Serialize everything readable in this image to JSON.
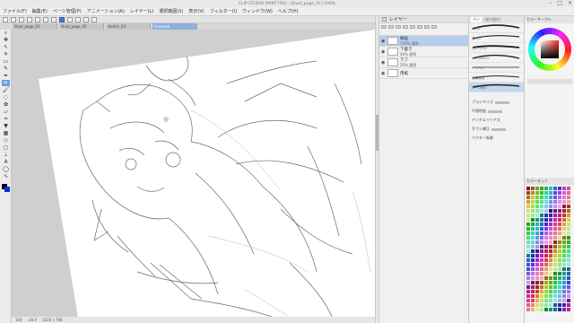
{
  "window": {
    "title": "CLIP STUDIO PAINT PRO - [illust_page_01] 100%"
  },
  "menu": {
    "items": [
      "ファイル(F)",
      "編集(E)",
      "ページ管理(P)",
      "アニメーション(A)",
      "レイヤー(L)",
      "選択範囲(S)",
      "表示(V)",
      "フィルター(I)",
      "ウィンドウ(W)",
      "ヘルプ(H)"
    ]
  },
  "doc_tabs": [
    "illust_page_01",
    "illust_page_02",
    "sketch_03",
    "linework"
  ],
  "layers": {
    "header": "レイヤー",
    "items": [
      {
        "name": "線画",
        "sub": "100% 通常",
        "visible": "◉"
      },
      {
        "name": "下書き",
        "sub": "40% 通常",
        "visible": "◉"
      },
      {
        "name": "ラフ",
        "sub": "20% 通常",
        "visible": "◉"
      },
      {
        "name": "用紙",
        "sub": "",
        "visible": "◉"
      }
    ]
  },
  "brush": {
    "tabs": [
      "ペン",
      "マーカー"
    ],
    "strokes": [
      "Gペン",
      "丸ペン",
      "カブラペン",
      "リアルGペン",
      "ミリペン",
      "効果線用",
      "トーン削り"
    ],
    "props": [
      "ブラシサイズ",
      "不透明度",
      "アンチエイリアス",
      "手ブレ補正",
      "ベクター吸着"
    ]
  },
  "color": {
    "header": "カラーサークル",
    "palette_header": "カラーセット"
  },
  "status": {
    "zoom": "100",
    "angle": "-20.0",
    "pos": "1024 x 768"
  },
  "colors": {
    "accent": "#4a7ec9",
    "selected_layer": "#b6cdec"
  }
}
